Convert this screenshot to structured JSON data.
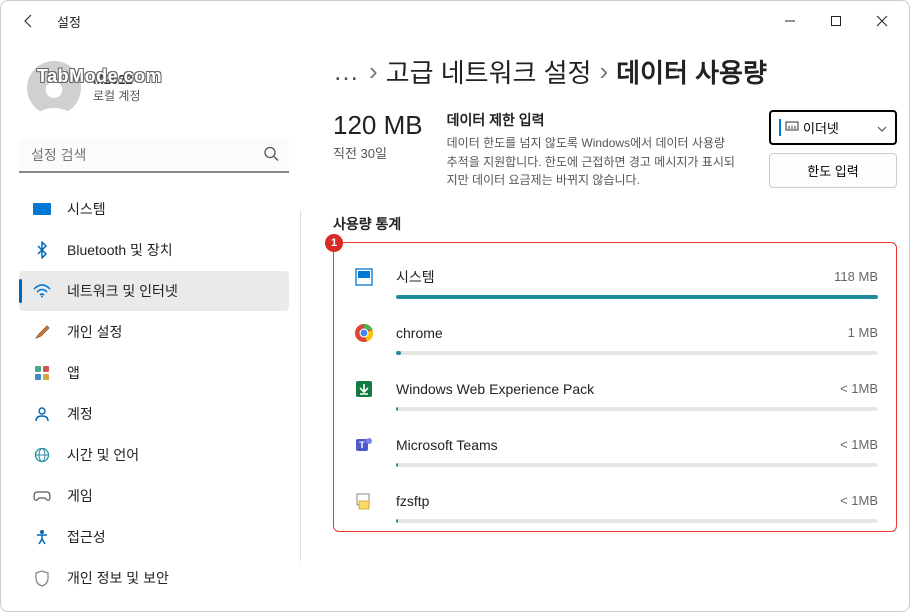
{
  "window": {
    "title": "설정"
  },
  "watermark": "TabMode.com",
  "user": {
    "name": "M2022",
    "type": "로컬 계정"
  },
  "search": {
    "placeholder": "설정 검색"
  },
  "sidebar": {
    "items": [
      {
        "label": "시스템"
      },
      {
        "label": "Bluetooth 및 장치"
      },
      {
        "label": "네트워크 및 인터넷"
      },
      {
        "label": "개인 설정"
      },
      {
        "label": "앱"
      },
      {
        "label": "계정"
      },
      {
        "label": "시간 및 언어"
      },
      {
        "label": "게임"
      },
      {
        "label": "접근성"
      },
      {
        "label": "개인 정보 및 보안"
      }
    ]
  },
  "breadcrumb": {
    "ellipsis": "…",
    "parent": "고급 네트워크 설정",
    "current": "데이터 사용량"
  },
  "usage": {
    "amount": "120 MB",
    "period": "직전 30일"
  },
  "limit": {
    "title": "데이터 제한 입력",
    "desc": "데이터 한도를 넘지 않도록 Windows에서 데이터 사용량 추적을 지원합니다. 한도에 근접하면 경고 메시지가 표시되지만 데이터 요금제는 바뀌지 않습니다."
  },
  "controls": {
    "dropdown_label": "이더넷",
    "button_label": "한도 입력"
  },
  "stats": {
    "title": "사용량 통계",
    "badge": "1",
    "apps": [
      {
        "name": "시스템",
        "usage": "118 MB",
        "pct": 100
      },
      {
        "name": "chrome",
        "usage": "1 MB",
        "pct": 1
      },
      {
        "name": "Windows Web Experience Pack",
        "usage": "< 1MB",
        "pct": 0.5
      },
      {
        "name": "Microsoft Teams",
        "usage": "< 1MB",
        "pct": 0.5
      },
      {
        "name": "fzsftp",
        "usage": "< 1MB",
        "pct": 0.5
      }
    ]
  }
}
